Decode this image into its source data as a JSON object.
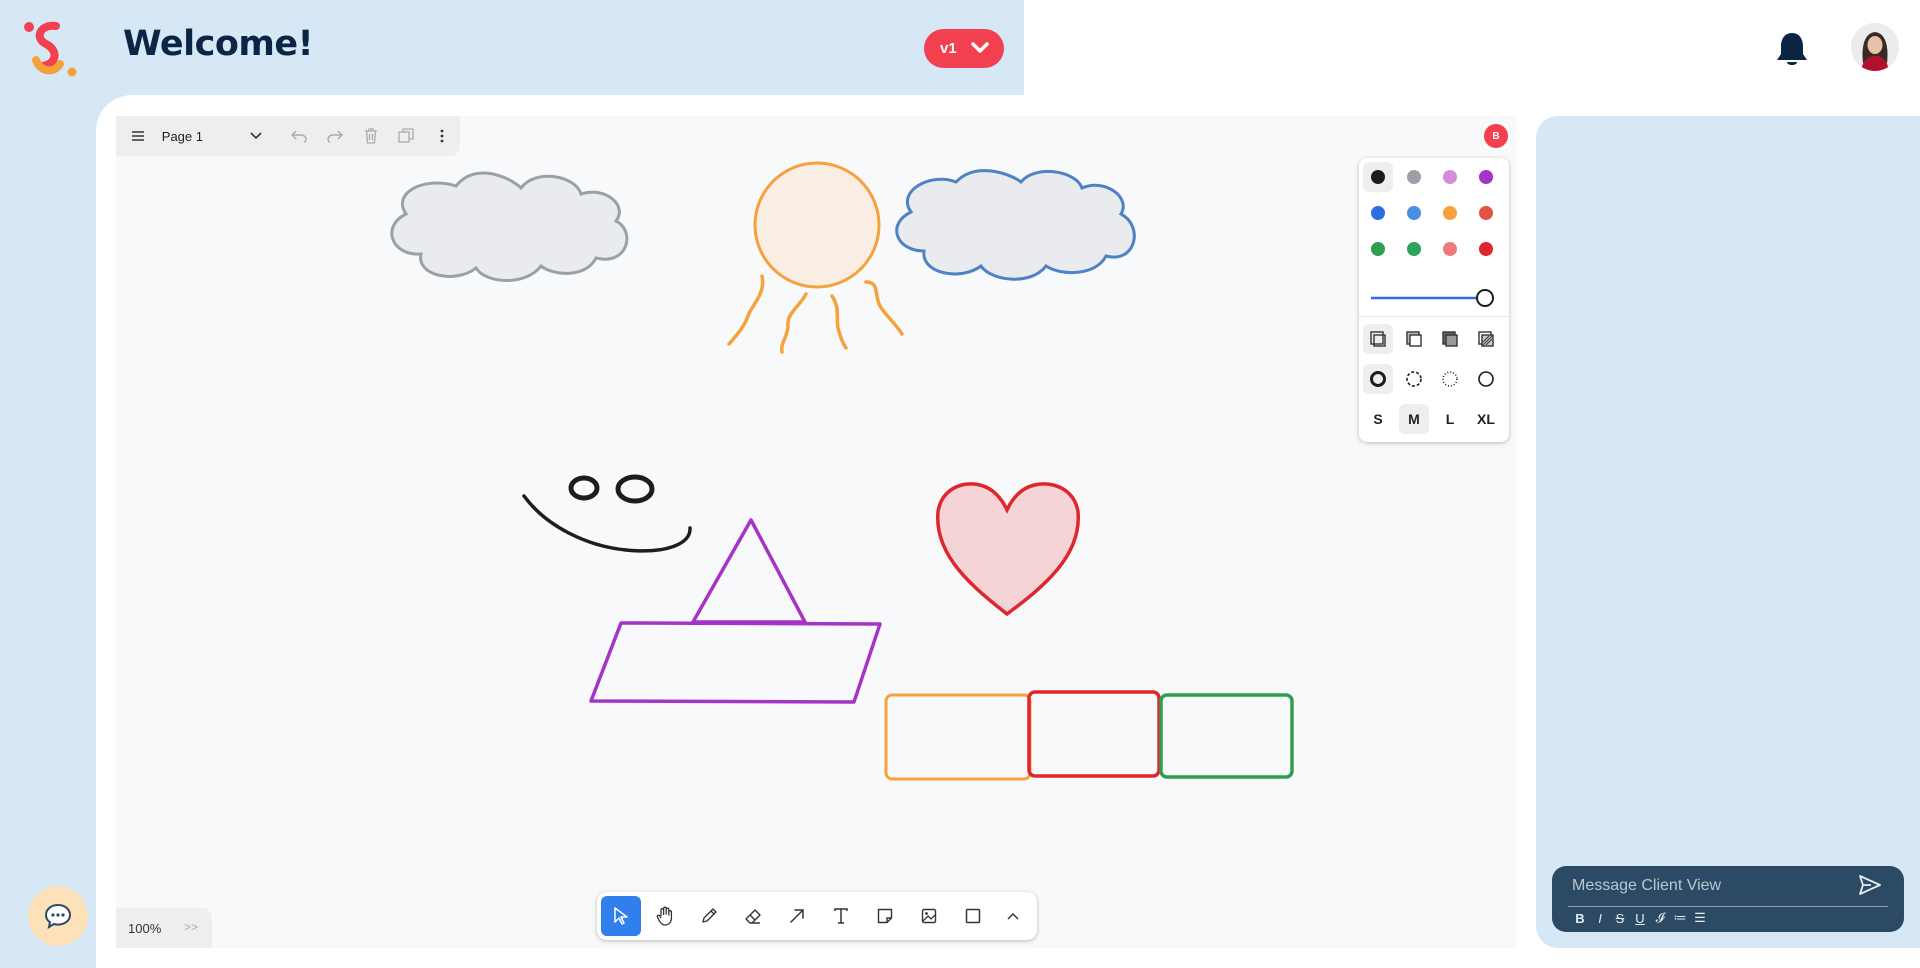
{
  "header": {
    "title": "Welcome!",
    "version_label": "v1"
  },
  "canvas": {
    "page_name": "Page 1",
    "presence_initial": "B",
    "zoom": "100%"
  },
  "style_panel": {
    "colors": [
      "#1d1d1d",
      "#9aa0a6",
      "#d48bd9",
      "#a633c7",
      "#2d6fe3",
      "#4a90e2",
      "#f5a13c",
      "#e55344",
      "#2f9e50",
      "#2ea35a",
      "#ef7a7a",
      "#e0262d"
    ],
    "selected_color_index": 0,
    "opacity": 1.0,
    "sizes": [
      "S",
      "M",
      "L",
      "XL"
    ],
    "selected_size": "M"
  },
  "toolbar": {
    "tools": [
      "select-tool",
      "hand-tool",
      "draw-tool",
      "eraser-tool",
      "arrow-tool",
      "text-tool",
      "note-tool",
      "image-tool",
      "rectangle-tool",
      "more-tools"
    ],
    "active_tool": "select-tool"
  },
  "message": {
    "placeholder": "Message Client View",
    "format_buttons": [
      "B",
      "I",
      "S",
      "U",
      "𝓘",
      "≔",
      "☰"
    ]
  }
}
